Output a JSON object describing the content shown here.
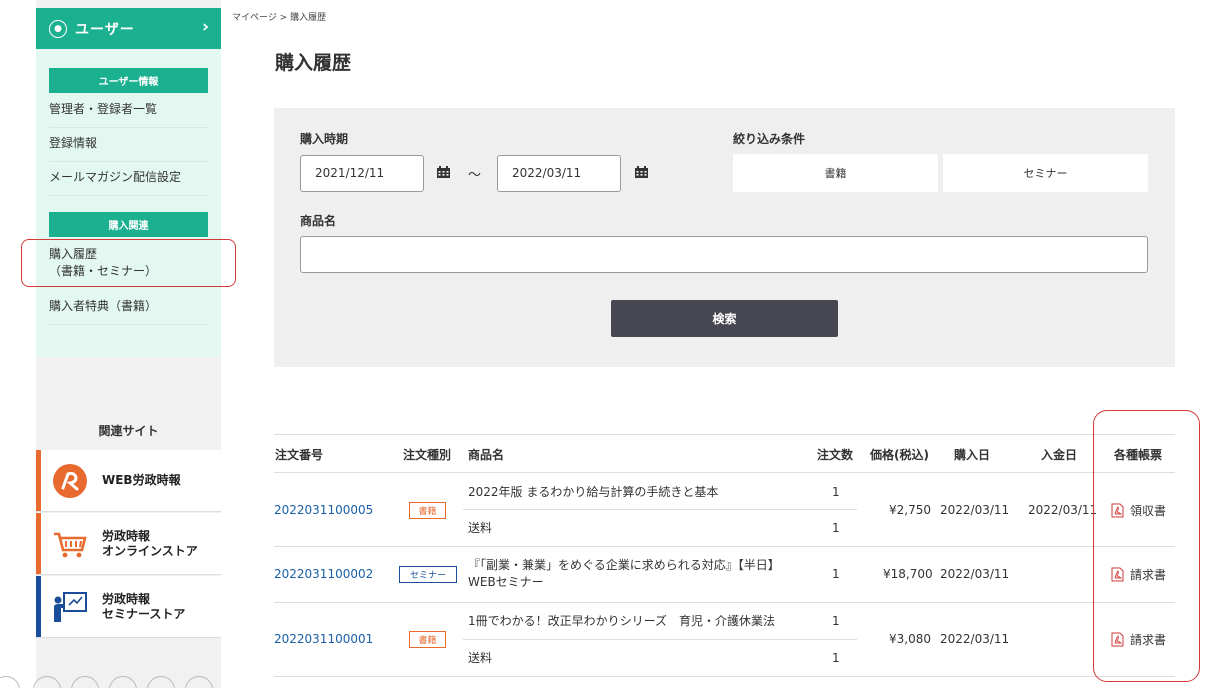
{
  "breadcrumb": "マイページ > 購入履歴",
  "page_title": "購入履歴",
  "sidebar": {
    "user_label": "ユーザー",
    "chevron": "›",
    "sections": [
      {
        "title": "ユーザー情報",
        "items": [
          "管理者・登録者一覧",
          "登録情報",
          "メールマガジン配信設定"
        ]
      },
      {
        "title": "購入関連",
        "items": [
          "購入履歴\n（書籍・セミナー）",
          "購入者特典（書籍）"
        ]
      }
    ],
    "related_title": "関連サイト",
    "related_sites": [
      {
        "label": "WEB労政時報",
        "icon": "web-rousei-logo-icon",
        "color": "#e86a2f"
      },
      {
        "label": "労政時報\nオンラインストア",
        "icon": "cart-icon",
        "color": "#e86a2f"
      },
      {
        "label": "労政時報\nセミナーストア",
        "icon": "presenter-icon",
        "color": "#1a4e9a"
      }
    ]
  },
  "search": {
    "period_label": "購入時期",
    "date_from": "2021/12/11",
    "date_to": "2022/03/11",
    "tilde": "～",
    "filter_label": "絞り込み条件",
    "filter_options": [
      "書籍",
      "セミナー"
    ],
    "name_label": "商品名",
    "name_value": "",
    "search_button": "検索"
  },
  "table": {
    "headers": [
      "注文番号",
      "注文種別",
      "商品名",
      "注文数",
      "価格(税込)",
      "購入日",
      "入金日",
      "各種帳票"
    ],
    "orders": [
      {
        "order_no": "2022031100005",
        "type": "書籍",
        "items": [
          {
            "name": "2022年版 まるわかり給与計算の手続きと基本",
            "qty": "1"
          },
          {
            "name": "送料",
            "qty": "1"
          }
        ],
        "price": "¥2,750",
        "purchase_date": "2022/03/11",
        "payment_date": "2022/03/11",
        "document": "領収書"
      },
      {
        "order_no": "2022031100002",
        "type": "セミナー",
        "items": [
          {
            "name": "『「副業・兼業」をめぐる企業に求められる対応』【半日】\nWEBセミナー",
            "qty": "1"
          }
        ],
        "price": "¥18,700",
        "purchase_date": "2022/03/11",
        "payment_date": "",
        "document": "請求書"
      },
      {
        "order_no": "2022031100001",
        "type": "書籍",
        "items": [
          {
            "name": "1冊でわかる！改正早わかりシリーズ　育児・介護休業法",
            "qty": "1"
          },
          {
            "name": "送料",
            "qty": "1"
          }
        ],
        "price": "¥3,080",
        "purchase_date": "2022/03/11",
        "payment_date": "",
        "document": "請求書"
      }
    ]
  },
  "colors": {
    "accent": "#1bb08f",
    "menu_bg": "#e3f8f1",
    "link": "#1a5fa8",
    "highlight": "#d33a3a",
    "button": "#474751"
  }
}
